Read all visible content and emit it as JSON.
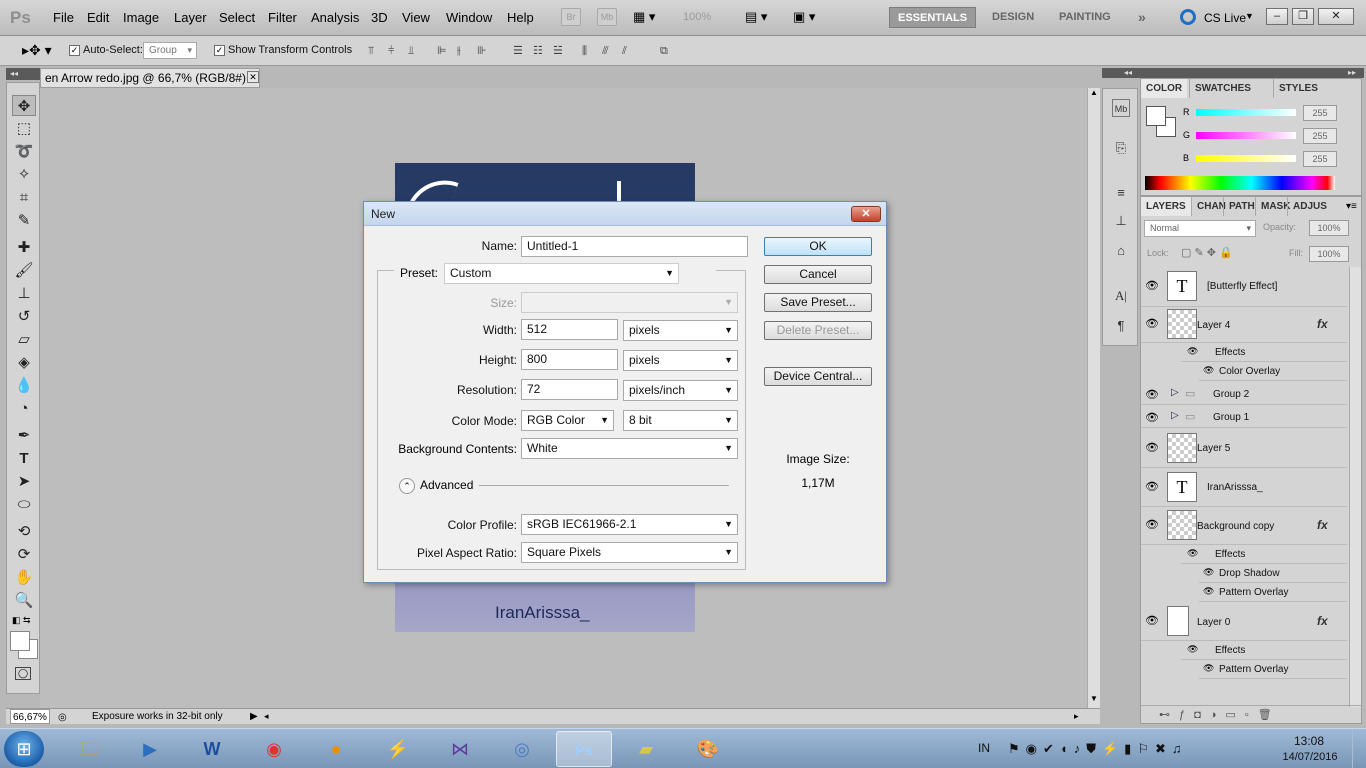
{
  "app": {
    "logo": "Ps"
  },
  "menubar": {
    "items": [
      "File",
      "Edit",
      "Image",
      "Layer",
      "Select",
      "Filter",
      "Analysis",
      "3D",
      "View",
      "Window",
      "Help"
    ],
    "bridge": "Br",
    "minibridge": "Mb",
    "zoom": "100%",
    "workspaces": [
      "ESSENTIALS",
      "DESIGN",
      "PAINTING"
    ],
    "more": "»",
    "cslive": "CS Live",
    "win_min": "–",
    "win_restore": "❐",
    "win_close": "✕"
  },
  "options": {
    "autoselect_label": "Auto-Select:",
    "autoselect_value": "Group",
    "transform_label": "Show Transform Controls"
  },
  "document": {
    "tab_title": "en Arrow redo.jpg @ 66,7% (RGB/8#) *",
    "close": "✕",
    "image_text": "IranArisssa_",
    "zoom": "66,67%",
    "status": "Exposure works in 32-bit only"
  },
  "color_panel": {
    "tabs": [
      "COLOR",
      "SWATCHES",
      "STYLES"
    ],
    "r_label": "R",
    "g_label": "G",
    "b_label": "B",
    "r": "255",
    "g": "255",
    "b": "255"
  },
  "layers_panel": {
    "tabs": [
      "LAYERS",
      "CHAN",
      "PATH",
      "MASK",
      "ADJUS"
    ],
    "blend": "Normal",
    "opacity_label": "Opacity:",
    "opacity": "100%",
    "lock_label": "Lock:",
    "fill_label": "Fill:",
    "fill": "100%",
    "fx": "fx",
    "layers": [
      {
        "name": "[Butterfly Effect]"
      },
      {
        "name": "Layer 4",
        "effects_label": "Effects",
        "effects": [
          "Color Overlay"
        ]
      },
      {
        "name": "Group 2"
      },
      {
        "name": "Group 1"
      },
      {
        "name": "Layer 5"
      },
      {
        "name": "IranArisssa_"
      },
      {
        "name": "Background copy",
        "effects_label": "Effects",
        "effects": [
          "Drop Shadow",
          "Pattern Overlay"
        ]
      },
      {
        "name": "Layer 0",
        "effects_label": "Effects",
        "effects": [
          "Pattern Overlay"
        ]
      }
    ]
  },
  "dialog": {
    "title": "New",
    "close": "✕",
    "name_label": "Name:",
    "name_value": "Untitled-1",
    "preset_label": "Preset:",
    "preset_value": "Custom",
    "size_label": "Size:",
    "width_label": "Width:",
    "width_value": "512",
    "width_unit": "pixels",
    "height_label": "Height:",
    "height_value": "800",
    "height_unit": "pixels",
    "resolution_label": "Resolution:",
    "resolution_value": "72",
    "resolution_unit": "pixels/inch",
    "colormode_label": "Color Mode:",
    "colormode_value": "RGB Color",
    "bitdepth_value": "8 bit",
    "bg_label": "Background Contents:",
    "bg_value": "White",
    "advanced_label": "Advanced",
    "profile_label": "Color Profile:",
    "profile_value": "sRGB IEC61966-2.1",
    "aspect_label": "Pixel Aspect Ratio:",
    "aspect_value": "Square Pixels",
    "ok": "OK",
    "cancel": "Cancel",
    "save_preset": "Save Preset...",
    "delete_preset": "Delete Preset...",
    "device_central": "Device Central...",
    "image_size_label": "Image Size:",
    "image_size_value": "1,17M"
  },
  "taskbar": {
    "lang": "IN",
    "time": "13:08",
    "date": "14/07/2016"
  }
}
